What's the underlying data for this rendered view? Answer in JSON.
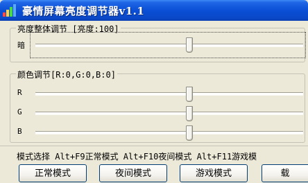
{
  "window": {
    "title": "豪情屏幕亮度调节器v1.1"
  },
  "brightness_group": {
    "legend": "亮度整体调节 [亮度:100]",
    "slider": {
      "label": "暗",
      "value": 100
    }
  },
  "color_group": {
    "legend": "颜色调节[R:0,G:0,B:0]",
    "sliders": [
      {
        "label": "R",
        "value": 0
      },
      {
        "label": "G",
        "value": 0
      },
      {
        "label": "B",
        "value": 0
      }
    ]
  },
  "mode_bar": {
    "text": "模式选择 Alt+F9正常模式 Alt+F10夜间模式 Alt+F11游戏模",
    "buttons": [
      {
        "label": "正常模式"
      },
      {
        "label": "夜间模式"
      },
      {
        "label": "游戏模式"
      },
      {
        "label": "载"
      }
    ]
  },
  "colors": {
    "title_bar": "#0a4fd6",
    "window_bg": "#ece9d8"
  }
}
